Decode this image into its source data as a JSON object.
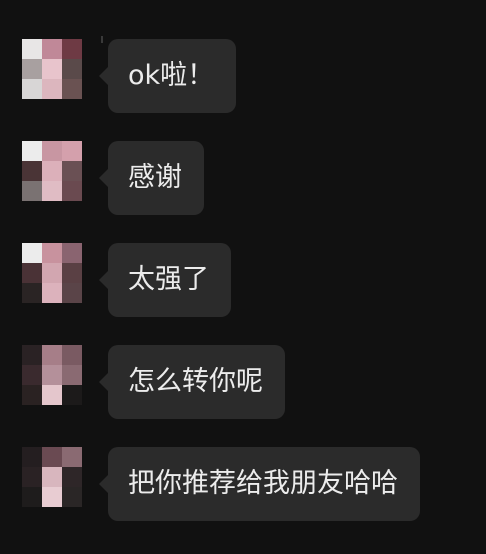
{
  "messages": [
    {
      "text": "ok啦！",
      "avatar_colors": [
        "#e8e6e6",
        "#c08898",
        "#6e3a44",
        "#a8a0a0",
        "#e8c4cc",
        "#5a4a4a",
        "#d8d6d6",
        "#dcb6be",
        "#6a5252"
      ]
    },
    {
      "text": "感谢",
      "avatar_colors": [
        "#ececec",
        "#c896a2",
        "#d4a0ac",
        "#4a3436",
        "#dcb0ba",
        "#6a5054",
        "#7a7272",
        "#e0bcc4",
        "#6a4a50"
      ]
    },
    {
      "text": "太强了",
      "avatar_colors": [
        "#ececec",
        "#c8929e",
        "#8a6470",
        "#4a3236",
        "#d2a6b0",
        "#5a4044",
        "#2a2424",
        "#dcb2bc",
        "#5a4448"
      ]
    },
    {
      "text": "怎么转你呢",
      "avatar_colors": [
        "#2a2224",
        "#a67e88",
        "#7a5a62",
        "#3a2a2e",
        "#b4909a",
        "#8a6a72",
        "#2a2222",
        "#e4c6cc",
        "#1c1a1a"
      ]
    },
    {
      "text": "把你推荐给我朋友哈哈",
      "avatar_colors": [
        "#241e20",
        "#6a4a52",
        "#8a6a72",
        "#2a2224",
        "#d8b6be",
        "#2e2628",
        "#1e1c1c",
        "#e8ccd2",
        "#2a2626"
      ]
    }
  ]
}
